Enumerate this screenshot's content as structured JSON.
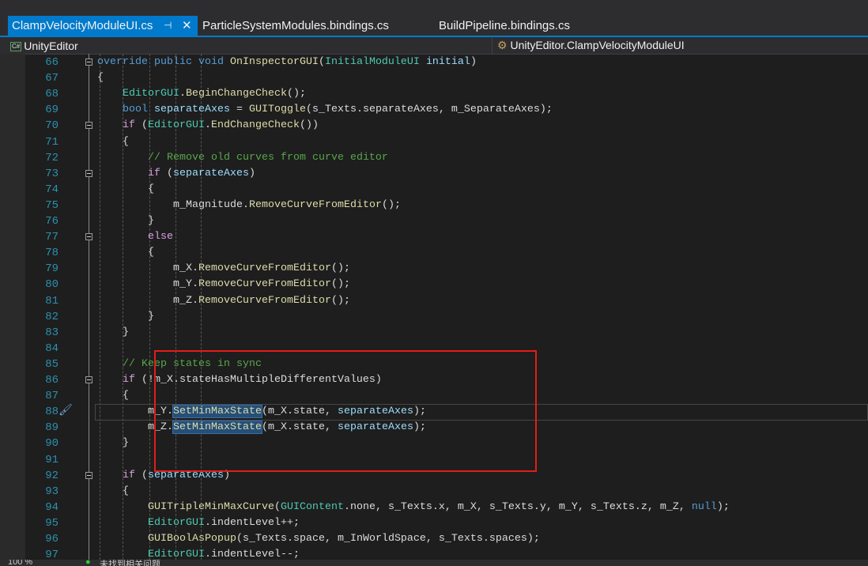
{
  "tabs": [
    {
      "label": "ClampVelocityModuleUI.cs",
      "active": true
    },
    {
      "label": "ParticleSystemModules.bindings.cs"
    },
    {
      "label": "BuildPipeline.bindings.cs"
    }
  ],
  "icons": {
    "pin": "pin-icon",
    "close": "close-icon",
    "csharp": "csharp-file-icon",
    "member": "member-icon"
  },
  "nav": {
    "project": "UnityEditor",
    "csharp_badge": "C#",
    "member": "UnityEditor.ClampVelocityModuleUI"
  },
  "colors": {
    "accent": "#007acc",
    "highlight_box": "#e51c1c"
  },
  "code": [
    {
      "n": "66",
      "i": 2,
      "fold": true,
      "t": [
        [
          "override public void",
          "k"
        ],
        [
          " ",
          "p"
        ],
        [
          "OnInspectorGUI",
          "m"
        ],
        [
          "(",
          "p"
        ],
        [
          "InitialModuleUI",
          "t"
        ],
        [
          " ",
          "p"
        ],
        [
          "initial",
          "v"
        ],
        [
          ")",
          "p"
        ]
      ]
    },
    {
      "n": "67",
      "i": 2,
      "t": [
        [
          "{",
          "p"
        ]
      ]
    },
    {
      "n": "68",
      "i": 3,
      "t": [
        [
          "EditorGUI",
          "t"
        ],
        [
          ".",
          "p"
        ],
        [
          "BeginChangeCheck",
          "m"
        ],
        [
          "();",
          "p"
        ]
      ]
    },
    {
      "n": "69",
      "i": 3,
      "t": [
        [
          "bool",
          "k"
        ],
        [
          " ",
          "p"
        ],
        [
          "separateAxes",
          "v"
        ],
        [
          " = ",
          "p"
        ],
        [
          "GUIToggle",
          "m"
        ],
        [
          "(s_Texts.separateAxes, m_SeparateAxes);",
          "p"
        ]
      ]
    },
    {
      "n": "70",
      "i": 3,
      "fold": true,
      "t": [
        [
          "if",
          "c"
        ],
        [
          " (",
          "p"
        ],
        [
          "EditorGUI",
          "t"
        ],
        [
          ".",
          "p"
        ],
        [
          "EndChangeCheck",
          "m"
        ],
        [
          "())",
          "p"
        ]
      ]
    },
    {
      "n": "71",
      "i": 3,
      "t": [
        [
          "{",
          "p"
        ]
      ]
    },
    {
      "n": "72",
      "i": 4,
      "t": [
        [
          "// Remove old curves from curve editor",
          "cm"
        ]
      ]
    },
    {
      "n": "73",
      "i": 4,
      "fold": true,
      "t": [
        [
          "if",
          "c"
        ],
        [
          " (",
          "p"
        ],
        [
          "separateAxes",
          "v"
        ],
        [
          ")",
          "p"
        ]
      ]
    },
    {
      "n": "74",
      "i": 4,
      "t": [
        [
          "{",
          "p"
        ]
      ]
    },
    {
      "n": "75",
      "i": 5,
      "t": [
        [
          "m_Magnitude.",
          "p"
        ],
        [
          "RemoveCurveFromEditor",
          "m"
        ],
        [
          "();",
          "p"
        ]
      ]
    },
    {
      "n": "76",
      "i": 4,
      "t": [
        [
          "}",
          "p"
        ]
      ]
    },
    {
      "n": "77",
      "i": 4,
      "fold": true,
      "t": [
        [
          "else",
          "c"
        ]
      ]
    },
    {
      "n": "78",
      "i": 4,
      "t": [
        [
          "{",
          "p"
        ]
      ]
    },
    {
      "n": "79",
      "i": 5,
      "t": [
        [
          "m_X.",
          "p"
        ],
        [
          "RemoveCurveFromEditor",
          "m"
        ],
        [
          "();",
          "p"
        ]
      ]
    },
    {
      "n": "80",
      "i": 5,
      "t": [
        [
          "m_Y.",
          "p"
        ],
        [
          "RemoveCurveFromEditor",
          "m"
        ],
        [
          "();",
          "p"
        ]
      ]
    },
    {
      "n": "81",
      "i": 5,
      "t": [
        [
          "m_Z.",
          "p"
        ],
        [
          "RemoveCurveFromEditor",
          "m"
        ],
        [
          "();",
          "p"
        ]
      ]
    },
    {
      "n": "82",
      "i": 4,
      "t": [
        [
          "}",
          "p"
        ]
      ]
    },
    {
      "n": "83",
      "i": 3,
      "t": [
        [
          "}",
          "p"
        ]
      ]
    },
    {
      "n": "84",
      "i": 3,
      "t": []
    },
    {
      "n": "85",
      "i": 3,
      "t": [
        [
          "// Keep states in sync",
          "cm"
        ]
      ]
    },
    {
      "n": "86",
      "i": 3,
      "fold": true,
      "t": [
        [
          "if",
          "c"
        ],
        [
          " (!m_X.stateHasMultipleDifferentValues)",
          "p"
        ]
      ]
    },
    {
      "n": "87",
      "i": 3,
      "t": [
        [
          "{",
          "p"
        ]
      ]
    },
    {
      "n": "88",
      "i": 4,
      "current": true,
      "t": [
        [
          "m_Y.",
          "p"
        ],
        [
          "SetMinMaxState",
          "h"
        ],
        [
          "(m_X.state, ",
          "p"
        ],
        [
          "separateAxes",
          "v"
        ],
        [
          ");",
          "p"
        ]
      ]
    },
    {
      "n": "89",
      "i": 4,
      "t": [
        [
          "m_Z.",
          "p"
        ],
        [
          "SetMinMaxState",
          "h"
        ],
        [
          "(m_X.state, ",
          "p"
        ],
        [
          "separateAxes",
          "v"
        ],
        [
          ");",
          "p"
        ]
      ]
    },
    {
      "n": "90",
      "i": 3,
      "t": [
        [
          "}",
          "p"
        ]
      ]
    },
    {
      "n": "91",
      "i": 3,
      "t": []
    },
    {
      "n": "92",
      "i": 3,
      "fold": true,
      "t": [
        [
          "if",
          "c"
        ],
        [
          " (",
          "p"
        ],
        [
          "separateAxes",
          "v"
        ],
        [
          ")",
          "p"
        ]
      ]
    },
    {
      "n": "93",
      "i": 3,
      "t": [
        [
          "{",
          "p"
        ]
      ]
    },
    {
      "n": "94",
      "i": 4,
      "t": [
        [
          "GUITripleMinMaxCurve",
          "m"
        ],
        [
          "(",
          "p"
        ],
        [
          "GUIContent",
          "t"
        ],
        [
          ".none, s_Texts.x, m_X, s_Texts.y, m_Y, s_Texts.z, m_Z, ",
          "p"
        ],
        [
          "null",
          "k"
        ],
        [
          ");",
          "p"
        ]
      ]
    },
    {
      "n": "95",
      "i": 4,
      "t": [
        [
          "EditorGUI",
          "t"
        ],
        [
          ".indentLevel++;",
          "p"
        ]
      ]
    },
    {
      "n": "96",
      "i": 4,
      "t": [
        [
          "GUIBoolAsPopup",
          "m"
        ],
        [
          "(s_Texts.space, m_InWorldSpace, s_Texts.spaces);",
          "p"
        ]
      ]
    },
    {
      "n": "97",
      "i": 4,
      "t": [
        [
          "EditorGUI",
          "t"
        ],
        [
          ".indentLevel--;",
          "p"
        ]
      ]
    }
  ],
  "status": {
    "zoom": "100 %",
    "issues": "未找到相关问题"
  }
}
